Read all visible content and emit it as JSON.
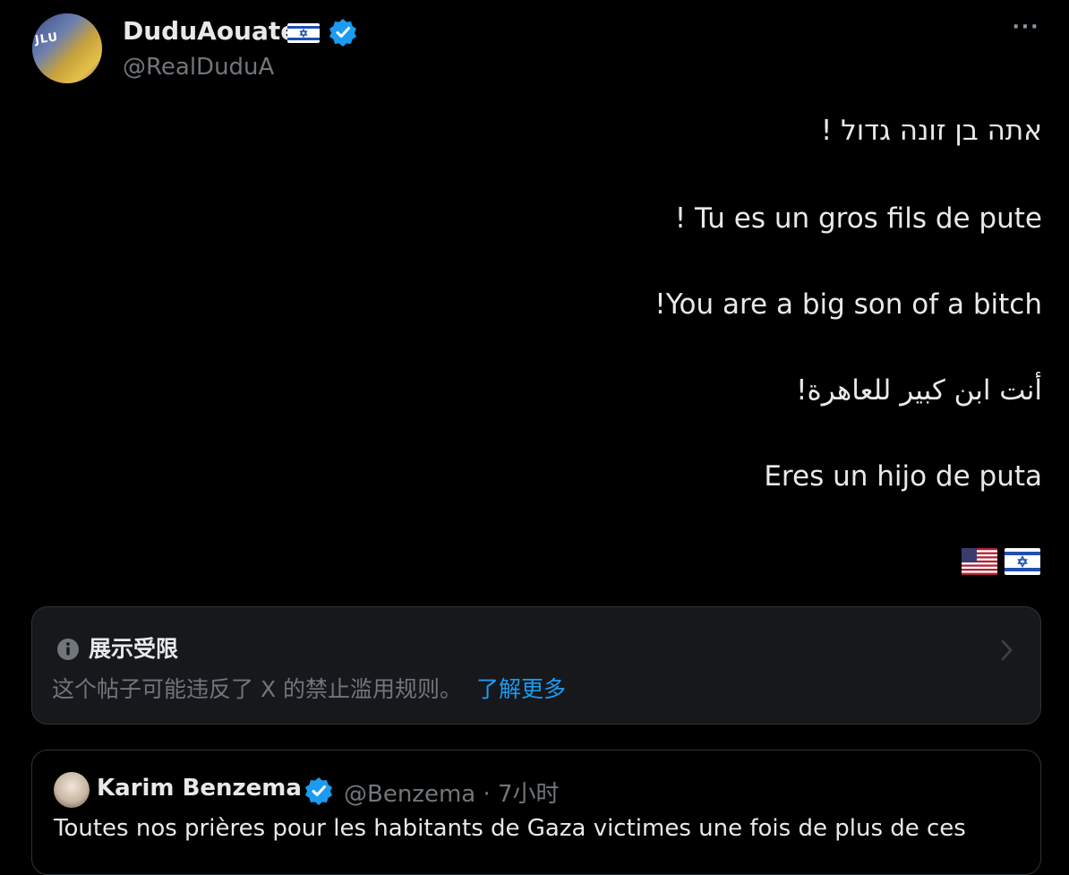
{
  "author": {
    "name": "DuduAouate",
    "handle": "@RealDuduA"
  },
  "more_label": "···",
  "body_lines": [
    "אתה בן זונה גדול !",
    "! Tu es un gros fils de pute",
    "!You are a big son of a bitch",
    "أنت ابن كبير للعاهرة!",
    "Eres un hijo de puta"
  ],
  "restricted": {
    "title": "展示受限",
    "description": "这个帖子可能违反了 X 的禁止滥用规则。",
    "link": "了解更多"
  },
  "quoted": {
    "name": "Karim Benzema",
    "handle_time": "@Benzema · 7小时",
    "text": "Toutes nos prières pour les habitants de Gaza victimes une fois de plus de ces"
  },
  "colors": {
    "background": "#000000",
    "text": "#e7e9ea",
    "muted": "#71767b",
    "accent": "#1d9bf0",
    "card": "#16181c",
    "border": "#2f3336"
  },
  "icons": {
    "verified": "verified-badge-icon",
    "israel_flag": "israel-flag-icon",
    "us_flag": "us-flag-icon",
    "info": "info-icon",
    "chevron": "chevron-right-icon",
    "more": "more-icon"
  }
}
